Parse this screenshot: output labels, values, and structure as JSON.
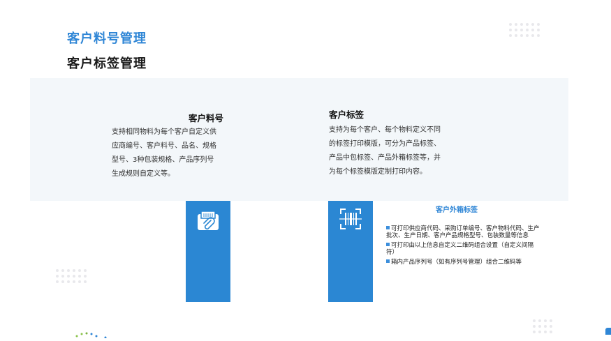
{
  "header": {
    "title_primary": "客户料号管理",
    "title_secondary": "客户标签管理"
  },
  "columns": [
    {
      "title": "客户料号",
      "lines": [
        "支持相同物料为每个客户自定义供",
        "应商编号、客户料号、品名、规格",
        "型号、3种包装规格、产品序列号",
        "生成规则自定义等。"
      ],
      "icon": "document-clip-icon"
    },
    {
      "title": "客户标签",
      "lines": [
        "支持为每个客户、每个物料定义不同",
        "的标签打印模版，可分为产品标签、",
        "产品中包标签、产品外箱标签等，并",
        "为每个标签模版定制打印内容。"
      ],
      "icon": "barcode-scan-icon"
    }
  ],
  "outer_label": {
    "title": "客户外箱标签",
    "bullets": [
      "可打印供应商代码、采购订单编号、客户物料代码、生产批次、生产日期、客户产品规格型号、包装数量等信息",
      "可打印由以上信息自定义二维码组合设置（自定义间隔符）",
      "箱内产品序列号（如有序列号管理）组合二维码等"
    ]
  },
  "colors": {
    "accent": "#2f86d6",
    "bar": "#2b87d3",
    "panel": "#f3f7fa"
  }
}
